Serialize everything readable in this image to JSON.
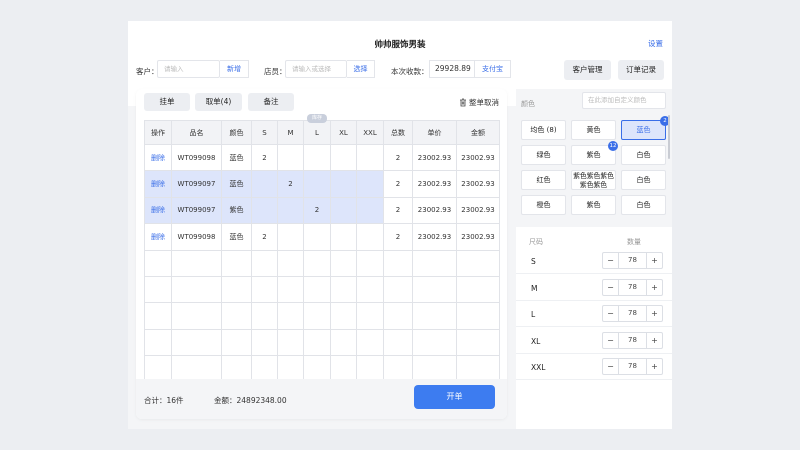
{
  "app": {
    "title": "帅帅服饰男装",
    "settings_label": "设置"
  },
  "header": {
    "customer_label": "客户：",
    "customer_placeholder": "请输入",
    "add_label": "新增",
    "clerk_label": "店员：",
    "clerk_placeholder": "请输入或选择",
    "select_label": "选择",
    "receipt_label": "本次收款：",
    "receipt_value": "29928.89",
    "payment_method": "支付宝",
    "customer_mgmt_label": "客户管理",
    "order_records_label": "订单记录"
  },
  "toolbar": {
    "hang_label": "挂单",
    "take_label": "取单(4)",
    "note_label": "备注",
    "cancel_all_label": "整单取消"
  },
  "table": {
    "headers": [
      "操作",
      "品名",
      "颜色",
      "S",
      "M",
      "L",
      "XL",
      "XXL",
      "总数",
      "单价",
      "金额"
    ],
    "l_badge": "库存",
    "rows": [
      {
        "op": "删除",
        "name": "WT099098",
        "color": "蓝色",
        "S": "2",
        "M": "",
        "L": "",
        "XL": "",
        "XXL": "",
        "total": "2",
        "price": "23002.93",
        "amount": "23002.93",
        "selected": false
      },
      {
        "op": "删除",
        "name": "WT099097",
        "color": "蓝色",
        "S": "",
        "M": "2",
        "L": "",
        "XL": "",
        "XXL": "",
        "total": "2",
        "price": "23002.93",
        "amount": "23002.93",
        "selected": true
      },
      {
        "op": "删除",
        "name": "WT099097",
        "color": "紫色",
        "S": "",
        "M": "",
        "L": "2",
        "XL": "",
        "XXL": "",
        "total": "2",
        "price": "23002.93",
        "amount": "23002.93",
        "selected": true
      },
      {
        "op": "删除",
        "name": "WT099098",
        "color": "蓝色",
        "S": "2",
        "M": "",
        "L": "",
        "XL": "",
        "XXL": "",
        "total": "2",
        "price": "23002.93",
        "amount": "23002.93",
        "selected": false
      }
    ],
    "empty_rows": 5
  },
  "footer": {
    "total_count": "合计：16件",
    "total_amount": "金额：24892348.00",
    "open_order_label": "开单"
  },
  "colors": {
    "section_label": "颜色",
    "custom_placeholder": "在此添加自定义颜色",
    "chips": [
      {
        "label": "均色 (8)",
        "active": false,
        "badge": ""
      },
      {
        "label": "黄色",
        "active": false,
        "badge": ""
      },
      {
        "label": "蓝色",
        "active": true,
        "badge": "2"
      },
      {
        "label": "绿色",
        "active": false,
        "badge": ""
      },
      {
        "label": "紫色",
        "active": false,
        "badge": "12"
      },
      {
        "label": "白色",
        "active": false,
        "badge": ""
      },
      {
        "label": "红色",
        "active": false,
        "badge": ""
      },
      {
        "label": "紫色紫色紫色紫色紫色",
        "active": false,
        "badge": ""
      },
      {
        "label": "白色",
        "active": false,
        "badge": ""
      },
      {
        "label": "橙色",
        "active": false,
        "badge": ""
      },
      {
        "label": "紫色",
        "active": false,
        "badge": ""
      },
      {
        "label": "白色",
        "active": false,
        "badge": ""
      }
    ]
  },
  "sizes": {
    "size_header": "尺码",
    "qty_header": "数量",
    "rows": [
      {
        "name": "S",
        "qty": "78"
      },
      {
        "name": "M",
        "qty": "78"
      },
      {
        "name": "L",
        "qty": "78"
      },
      {
        "name": "XL",
        "qty": "78"
      },
      {
        "name": "XXL",
        "qty": "78"
      }
    ]
  },
  "theme": {
    "accent": "#3d7cf0",
    "selected_row": "#dde5fb",
    "background": "#eceef2"
  }
}
